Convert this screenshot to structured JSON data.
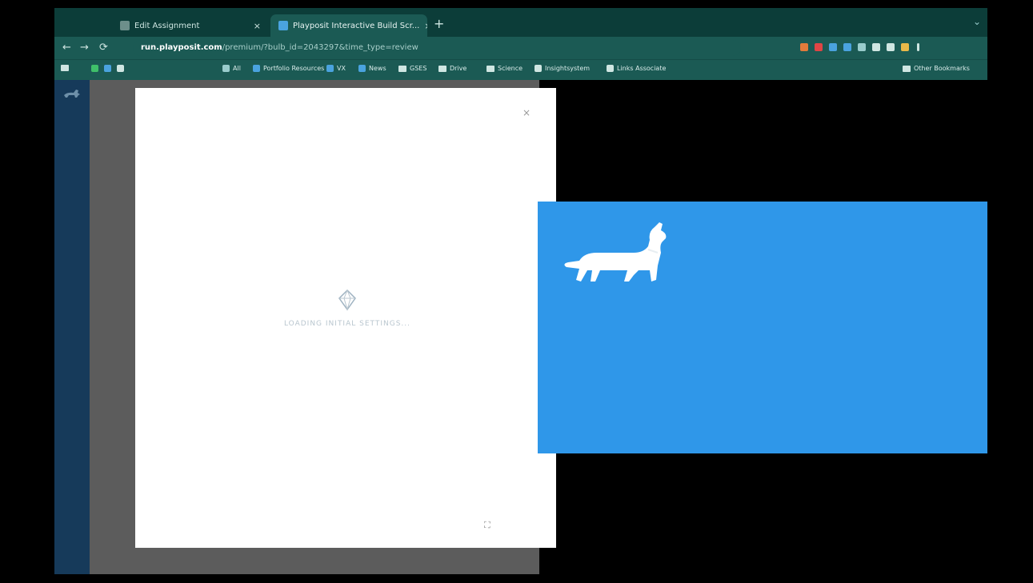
{
  "browser": {
    "tabs": [
      {
        "label": "Edit Assignment",
        "close": "×"
      },
      {
        "label": "Playposit Interactive Build Scr...",
        "close": "×"
      }
    ],
    "new_tab": "+",
    "window_controls": "⌄",
    "nav": {
      "back": "←",
      "forward": "→",
      "reload": "⟳"
    },
    "url": {
      "host": "run.playposit.com",
      "path": "/premium/?bulb_id=2043297&time_type=review"
    },
    "bookmarks": [
      "All",
      "Portfolio Resources",
      "VX",
      "News",
      "GSES",
      "Drive",
      "Science",
      "Insightsystem",
      "Links Associate"
    ],
    "bookmarks_right": "Other Bookmarks"
  },
  "modal": {
    "close": "×",
    "loading_text": "LOADING INITIAL SETTINGS...",
    "corner_icon": "⛶"
  },
  "colors": {
    "chrome": "#1b5a54",
    "tabbar": "#0c3d39",
    "preview": "#2f97e9",
    "overlay": "#5c5c5c",
    "rail": "#163a5a"
  },
  "icons": {
    "rail_logo": "dog-logo-icon",
    "loader": "diamond-loader-icon",
    "preview": "dachshund-icon"
  }
}
